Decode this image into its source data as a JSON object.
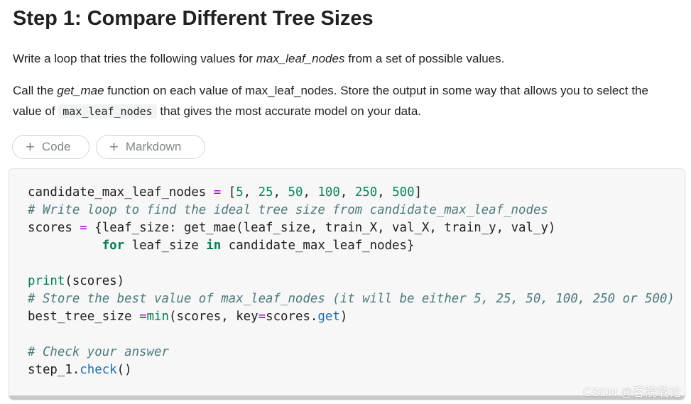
{
  "title": "Step 1: Compare Different Tree Sizes",
  "para1": {
    "before": "Write a loop that tries the following values for ",
    "em": "max_leaf_nodes",
    "after": " from a set of possible values."
  },
  "para2": {
    "line1_before": "Call the ",
    "line1_em": "get_mae",
    "line1_after": " function on each value of max_leaf_nodes. Store the output in some way that allows you to select the",
    "line2_before": "value of ",
    "line2_code": "max_leaf_nodes",
    "line2_after": " that gives the most accurate model on your data."
  },
  "buttons": {
    "plus": "+",
    "code": "Code",
    "markdown": "Markdown"
  },
  "code": {
    "l1_a": "candidate_max_leaf_nodes ",
    "l1_eq": "=",
    "l1_b": " [",
    "l1_n1": "5",
    "l1_n2": "25",
    "l1_n3": "50",
    "l1_n4": "100",
    "l1_n5": "250",
    "l1_n6": "500",
    "l1_sep": ", ",
    "l1_end": "]",
    "l2": "# Write loop to find the ideal tree size from candidate_max_leaf_nodes",
    "l3_a": "scores ",
    "l3_eq": "=",
    "l3_b": " {leaf_size: get_mae(leaf_size, train_X, val_X, train_y, val_y)",
    "l4_indent": "          ",
    "l4_for": "for",
    "l4_mid": " leaf_size ",
    "l4_in": "in",
    "l4_end": " candidate_max_leaf_nodes}",
    "l6_print": "print",
    "l6_rest": "(scores)",
    "l7": "# Store the best value of max_leaf_nodes (it will be either 5, 25, 50, 100, 250 or 500)",
    "l8_a": "best_tree_size ",
    "l8_eq": "=",
    "l8_min": "min",
    "l8_b": "(scores, key",
    "l8_eq2": "=",
    "l8_c": "scores.",
    "l8_get": "get",
    "l8_end": ")",
    "l10": "# Check your answer",
    "l11_a": "step_1.",
    "l11_check": "check",
    "l11_end": "()"
  },
  "watermark": "CSDN @客院载论"
}
